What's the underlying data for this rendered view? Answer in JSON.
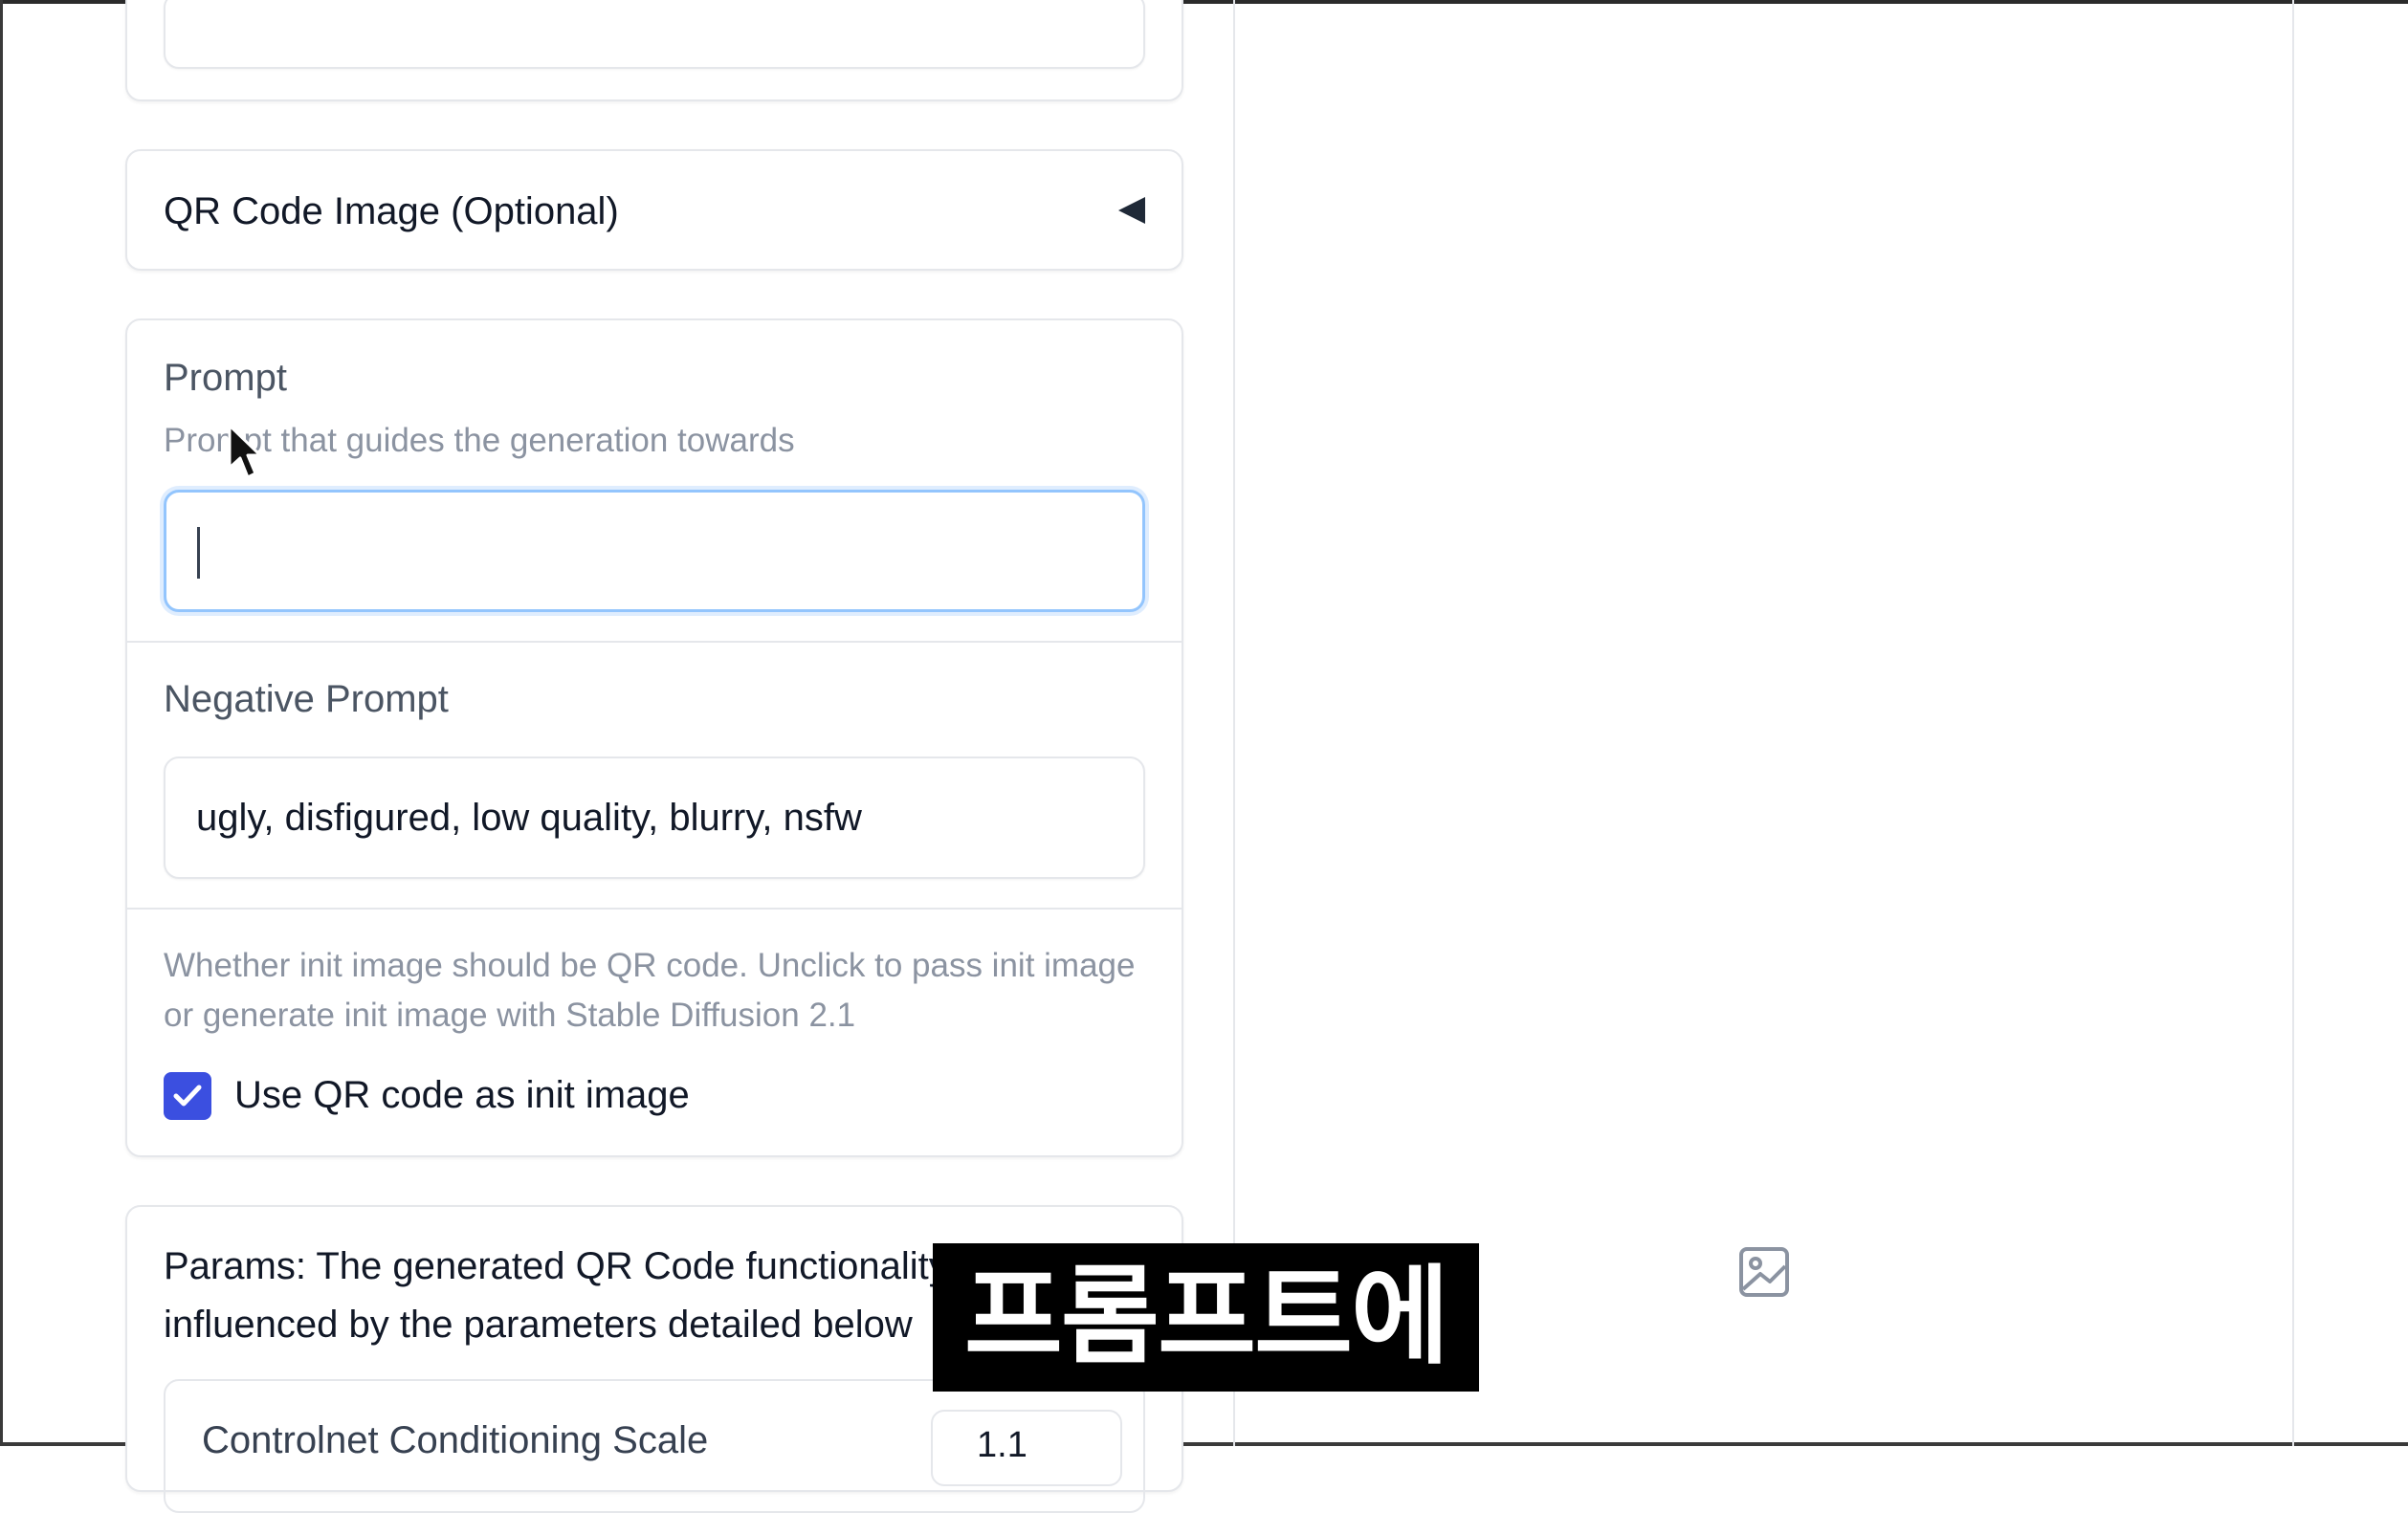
{
  "qr_accordion": {
    "title": "QR Code Image (Optional)"
  },
  "prompt": {
    "label": "Prompt",
    "info": "Prompt that guides the generation towards",
    "value": ""
  },
  "negative_prompt": {
    "label": "Negative Prompt",
    "value": "ugly, disfigured, low quality, blurry, nsfw"
  },
  "init_image": {
    "info_line1": "Whether init image should be QR code. Unclick to pass init image",
    "info_line2": "or generate init image with Stable Diffusion 2.1",
    "checkbox_label": "Use QR code as init image",
    "checked": true
  },
  "params": {
    "text_line1": "Params: The generated QR Code functionality",
    "text_line2": "influenced by the parameters detailed below",
    "controlnet_label": "Controlnet Conditioning Scale",
    "controlnet_value": "1.1"
  },
  "output": {
    "placeholder_icon": "image-icon"
  },
  "subtitle": {
    "text": "프롬프트에"
  },
  "colors": {
    "accent": "#3b4fe0",
    "focus_border": "#93c5fd",
    "border": "#e5e7eb"
  }
}
